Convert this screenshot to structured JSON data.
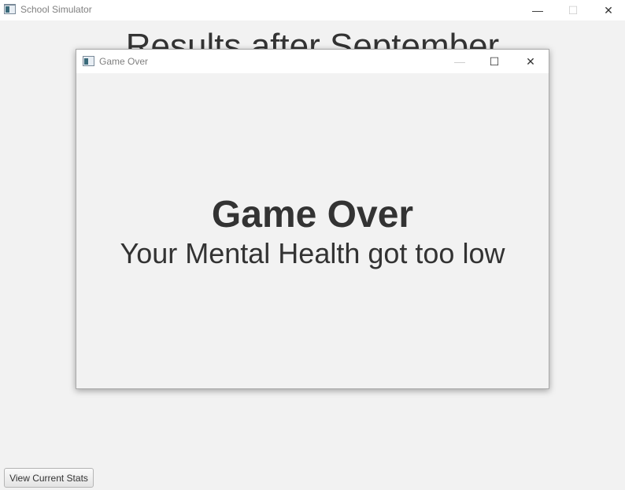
{
  "main_window": {
    "title": "School Simulator",
    "controls": {
      "minimize": "—",
      "maximize": "☐",
      "close": "✕"
    },
    "background_heading": "Results after September",
    "stats_button_label": "View Current Stats"
  },
  "dialog": {
    "title": "Game Over",
    "controls": {
      "minimize": "—",
      "maximize": "☐",
      "close": "✕"
    },
    "heading": "Game Over",
    "message": "Your Mental Health got too low"
  },
  "icons": {
    "app": "window-app-icon",
    "minimize": "minimize-icon",
    "maximize": "maximize-icon",
    "close": "close-icon"
  },
  "colors": {
    "background": "#f2f2f2",
    "titlebar": "#ffffff",
    "text": "#333333",
    "title_text": "#808080"
  }
}
